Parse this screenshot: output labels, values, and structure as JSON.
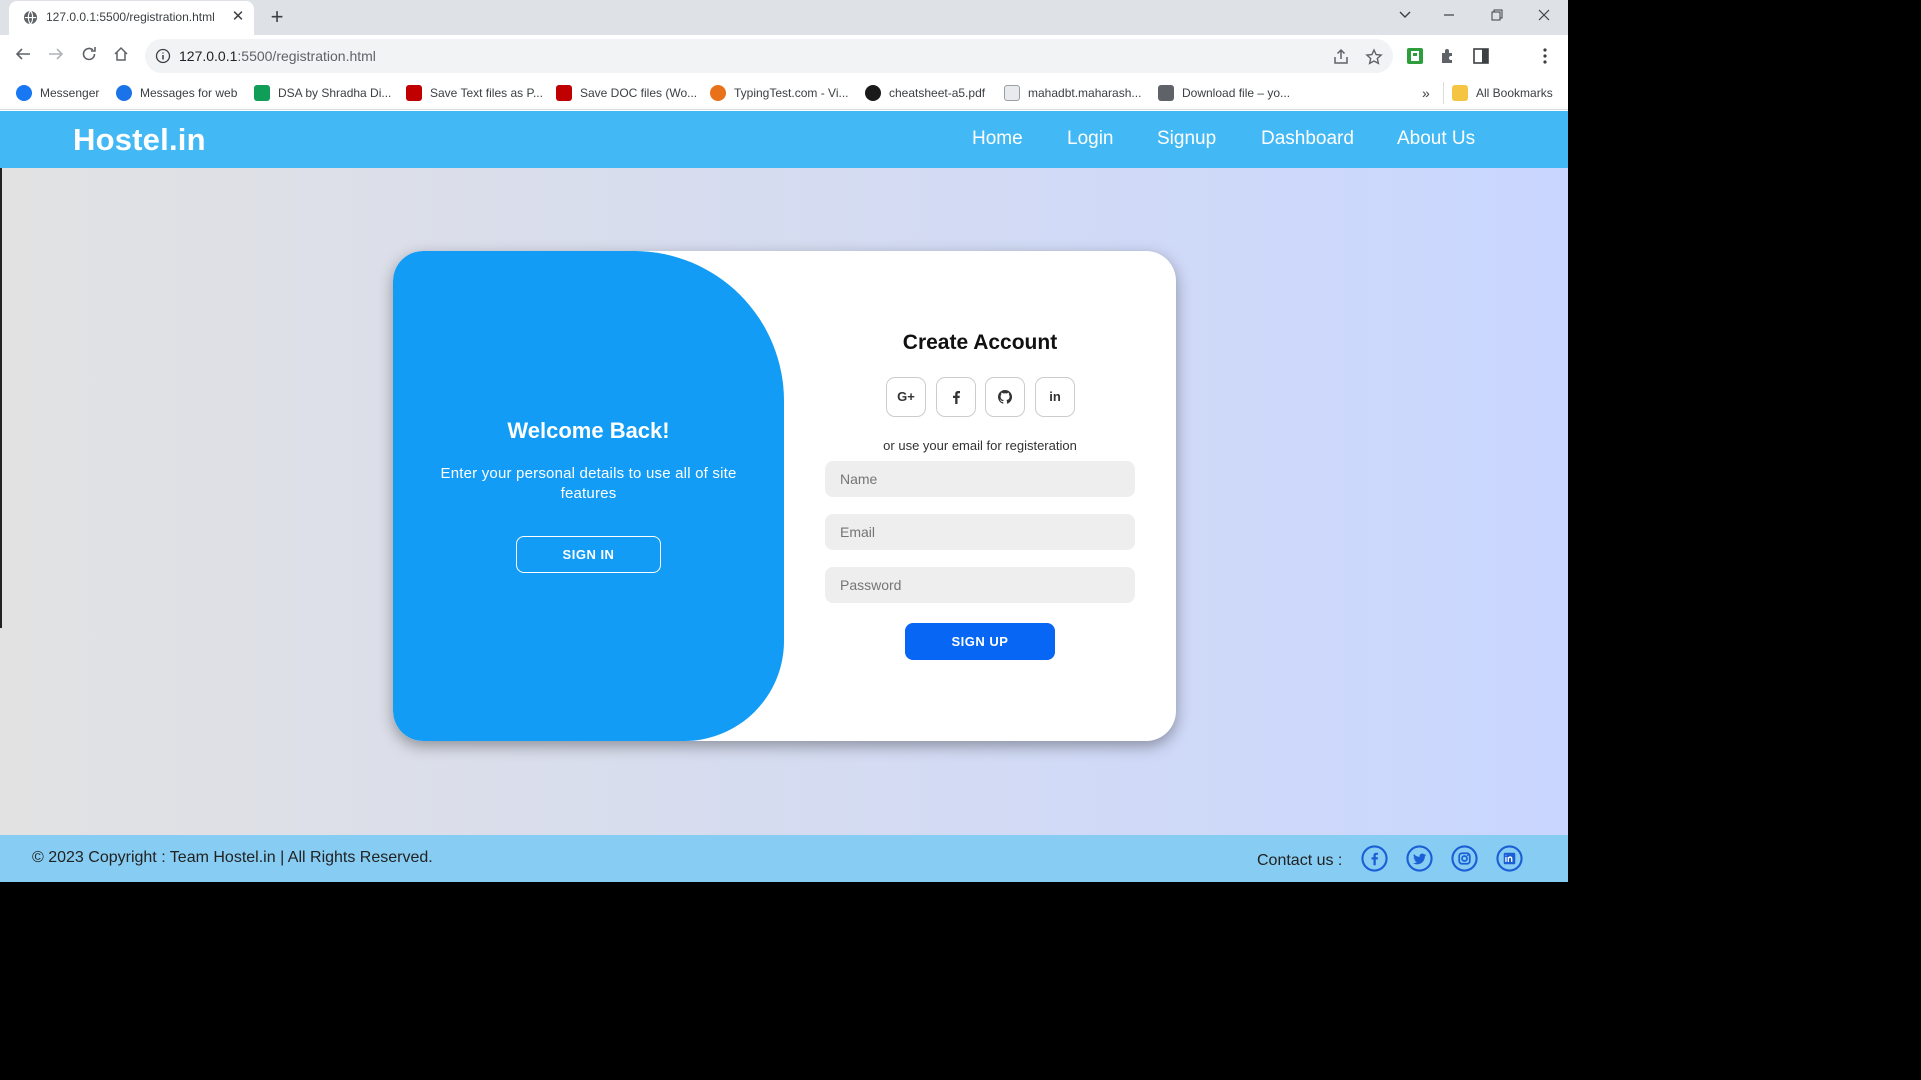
{
  "browser": {
    "tab_title": "127.0.0.1:5500/registration.html",
    "url_host": "127.0.0.1",
    "url_path": ":5500/registration.html",
    "bookmarks": [
      {
        "label": "Messenger",
        "color": "#1877f2"
      },
      {
        "label": "Messages for web",
        "color": "#1a73e8"
      },
      {
        "label": "DSA by Shradha Di...",
        "color": "#0f9d58"
      },
      {
        "label": "Save Text files as P...",
        "color": "#c00000"
      },
      {
        "label": "Save DOC files (Wo...",
        "color": "#c00000"
      },
      {
        "label": "TypingTest.com - Vi...",
        "color": "#e8711a"
      },
      {
        "label": "cheatsheet-a5.pdf",
        "color": "#1a1a1a"
      },
      {
        "label": "mahadbt.maharash...",
        "color": "#9aa0a6"
      },
      {
        "label": "Download file – yo...",
        "color": "#5f6368"
      }
    ],
    "more_bookmarks": "»",
    "all_bookmarks": "All Bookmarks"
  },
  "site": {
    "brand": "Hostel.in",
    "nav": [
      "Home",
      "Login",
      "Signup",
      "Dashboard",
      "About Us"
    ],
    "colors": {
      "navbar": "#42b9f5",
      "panel": "#129cf5",
      "button": "#0866f4",
      "footer": "#87cdf3"
    }
  },
  "welcome": {
    "title": "Welcome Back!",
    "text": "Enter your personal details to use all of site features",
    "button": "SIGN IN"
  },
  "register": {
    "title": "Create Account",
    "social": [
      "G+",
      "f",
      "github",
      "in"
    ],
    "or_text": "or use your email for registeration",
    "name_placeholder": "Name",
    "email_placeholder": "Email",
    "password_placeholder": "Password",
    "button": "SIGN UP"
  },
  "footer": {
    "copyright": "© 2023 Copyright : Team Hostel.in | All Rights Reserved.",
    "contact_label": "Contact us :",
    "contact_icons": [
      "facebook-icon",
      "twitter-icon",
      "instagram-icon",
      "linkedin-icon"
    ]
  }
}
